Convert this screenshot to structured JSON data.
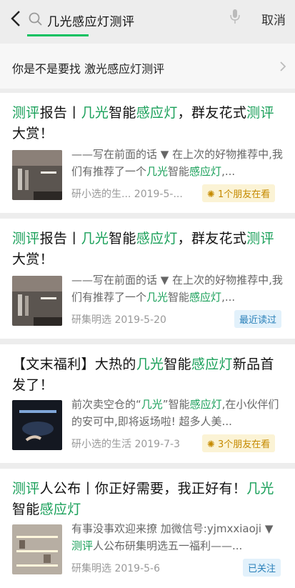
{
  "search": {
    "query": "几光感应灯测评",
    "cancel_label": "取消"
  },
  "suggestion": {
    "text": "你是不是要找 激光感应灯测评"
  },
  "results": [
    {
      "title": [
        [
          "测评",
          "h"
        ],
        [
          "报告丨",
          ""
        ],
        [
          "几光",
          "h"
        ],
        [
          "智能",
          ""
        ],
        [
          "感应灯",
          "h"
        ],
        [
          "，群友花式",
          ""
        ],
        [
          "测评",
          "h"
        ],
        [
          "大赏！",
          ""
        ]
      ],
      "snippet": [
        [
          "——写在前面的话 ▼ 在上次的好物推荐中,我们有推荐了一个",
          ""
        ],
        [
          "几光",
          "h"
        ],
        [
          "智能",
          ""
        ],
        [
          "感应灯",
          "h"
        ],
        [
          ",...",
          ""
        ]
      ],
      "source": "研小选的生...  2019-5-...",
      "badge": "1个朋友在看",
      "badge_type": "friends"
    },
    {
      "title": [
        [
          "测评",
          "h"
        ],
        [
          "报告丨",
          ""
        ],
        [
          "几光",
          "h"
        ],
        [
          "智能",
          ""
        ],
        [
          "感应灯",
          "h"
        ],
        [
          "，群友花式",
          ""
        ],
        [
          "测评",
          "h"
        ],
        [
          "大赏！",
          ""
        ]
      ],
      "snippet": [
        [
          "——写在前面的话 ▼ 在上次的好物推荐中,我们有推荐了一个",
          ""
        ],
        [
          "几光",
          "h"
        ],
        [
          "智能",
          ""
        ],
        [
          "感应灯",
          "h"
        ],
        [
          ",...",
          ""
        ]
      ],
      "source": "研集明选  2019-5-20",
      "badge": "最近读过",
      "badge_type": "blue"
    },
    {
      "title": [
        [
          "【文末福利】大热的",
          ""
        ],
        [
          "几光",
          "h"
        ],
        [
          "智能",
          ""
        ],
        [
          "感应灯",
          "h"
        ],
        [
          "新品首发了！",
          ""
        ]
      ],
      "snippet": [
        [
          "前次卖空仓的“",
          ""
        ],
        [
          "几光",
          "h"
        ],
        [
          "”智能",
          ""
        ],
        [
          "感应灯",
          "h"
        ],
        [
          ",在小伙伴们的安可中,即将返场啦! 超多人美...",
          ""
        ]
      ],
      "source": "研小选的生活  2019-7-3",
      "badge": "3个朋友在看",
      "badge_type": "friends"
    },
    {
      "title": [
        [
          "测评",
          "h"
        ],
        [
          "人公布丨你正好需要，我正好有！",
          ""
        ],
        [
          "几光",
          "h"
        ],
        [
          "智能",
          ""
        ],
        [
          "感应灯",
          "h"
        ]
      ],
      "snippet": [
        [
          "有事没事欢迎来撩 加微信号:yjmxxiaoji ▼ ",
          ""
        ],
        [
          "测评",
          "h"
        ],
        [
          "人公布研集明选五一福利——...",
          ""
        ]
      ],
      "source": "研集明选  2019-5-6",
      "badge": "已关注",
      "badge_type": "blue"
    }
  ],
  "colors": {
    "highlight": "#1aa05a",
    "accent": "#07c160"
  }
}
